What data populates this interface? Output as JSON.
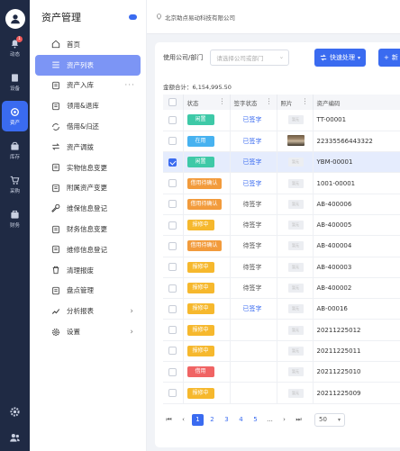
{
  "rail": {
    "items": [
      {
        "label": "动态",
        "icon": "bell-icon",
        "badge": "1",
        "active": false
      },
      {
        "label": "设备",
        "icon": "device-icon",
        "active": false
      },
      {
        "label": "资产",
        "icon": "asset-icon",
        "active": true
      },
      {
        "label": "库存",
        "icon": "inventory-icon",
        "active": false
      },
      {
        "label": "采购",
        "icon": "cart-icon",
        "active": false
      },
      {
        "label": "财务",
        "icon": "finance-icon",
        "active": false
      }
    ]
  },
  "subnav": {
    "title": "资产管理",
    "items": [
      {
        "label": "首页",
        "icon": "home-icon"
      },
      {
        "label": "资产列表",
        "icon": "list-icon",
        "active": true
      },
      {
        "label": "资产入库",
        "icon": "inbound-icon",
        "more": "···"
      },
      {
        "label": "领用&退库",
        "icon": "receive-icon"
      },
      {
        "label": "借用&归还",
        "icon": "borrow-icon"
      },
      {
        "label": "资产调拨",
        "icon": "transfer-icon"
      },
      {
        "label": "实物信息变更",
        "icon": "edit-doc-icon"
      },
      {
        "label": "附属资产变更",
        "icon": "attach-icon"
      },
      {
        "label": "维保信息登记",
        "icon": "wrench-icon"
      },
      {
        "label": "财务信息变更",
        "icon": "finance-doc-icon"
      },
      {
        "label": "维修信息登记",
        "icon": "repair-doc-icon"
      },
      {
        "label": "清理报废",
        "icon": "trash-icon"
      },
      {
        "label": "盘点管理",
        "icon": "check-list-icon"
      },
      {
        "label": "分析报表",
        "icon": "chart-icon",
        "arrow": "›"
      },
      {
        "label": "设置",
        "icon": "gear-icon",
        "arrow": "›"
      }
    ]
  },
  "topbar": {
    "company": "北京助点易动科技有限公司"
  },
  "filter": {
    "label": "使用公司/部门",
    "placeholder": "请选择公司或部门"
  },
  "buttons": {
    "quick": "快速处理",
    "new": "新"
  },
  "total": "金额合计：6,154,995.50",
  "table": {
    "headers": [
      "状态",
      "签字状态",
      "照片",
      "资产编码"
    ],
    "rows": [
      {
        "status": "闲置",
        "color": "#3ec9a7",
        "sign": "已签字",
        "photo": "暂无",
        "code": "TT-00001",
        "checked": false
      },
      {
        "status": "在用",
        "color": "#47b2f0",
        "sign": "已签字",
        "photo": "img",
        "code": "22335566443322",
        "checked": false
      },
      {
        "status": "闲置",
        "color": "#3ec9a7",
        "sign": "已签字",
        "photo": "暂无",
        "code": "YBM-00001",
        "checked": true
      },
      {
        "status": "借用待确认",
        "color": "#f29b3c",
        "sign": "已签字",
        "photo": "暂无",
        "code": "1001-00001",
        "checked": false
      },
      {
        "status": "借用待确认",
        "color": "#f29b3c",
        "sign": "待签字",
        "photo": "暂无",
        "code": "AB-400006",
        "checked": false
      },
      {
        "status": "报修中",
        "color": "#f6b82d",
        "sign": "待签字",
        "photo": "暂无",
        "code": "AB-400005",
        "checked": false
      },
      {
        "status": "借用待确认",
        "color": "#f29b3c",
        "sign": "待签字",
        "photo": "暂无",
        "code": "AB-400004",
        "checked": false
      },
      {
        "status": "报修中",
        "color": "#f6b82d",
        "sign": "待签字",
        "photo": "暂无",
        "code": "AB-400003",
        "checked": false
      },
      {
        "status": "报修中",
        "color": "#f6b82d",
        "sign": "待签字",
        "photo": "暂无",
        "code": "AB-400002",
        "checked": false
      },
      {
        "status": "报修中",
        "color": "#f6b82d",
        "sign": "已签字",
        "photo": "暂无",
        "code": "AB-00016",
        "checked": false
      },
      {
        "status": "报修中",
        "color": "#f6b82d",
        "sign": "",
        "photo": "暂无",
        "code": "20211225012",
        "checked": false
      },
      {
        "status": "报修中",
        "color": "#f6b82d",
        "sign": "",
        "photo": "暂无",
        "code": "20211225011",
        "checked": false
      },
      {
        "status": "借用",
        "color": "#f06464",
        "sign": "",
        "photo": "暂无",
        "code": "20211225010",
        "checked": false
      },
      {
        "status": "报修中",
        "color": "#f6b82d",
        "sign": "",
        "photo": "暂无",
        "code": "20211225009",
        "checked": false
      }
    ]
  },
  "pager": {
    "first": "⏮",
    "prev": "‹",
    "pages": [
      "1",
      "2",
      "3",
      "4",
      "5"
    ],
    "active": "1",
    "ellipsis": "...",
    "next": "›",
    "last": "⏭",
    "size": "50"
  }
}
